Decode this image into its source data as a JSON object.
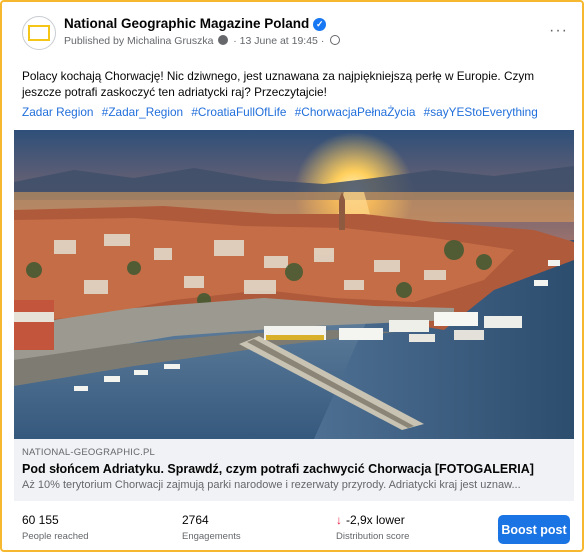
{
  "post": {
    "page_name": "National Geographic Magazine Poland",
    "meta": {
      "published_by": "Published by Michalina Gruszka",
      "date": "· 13 June at 19:45 ·"
    },
    "more_label": "···",
    "text": "Polacy kochają Chorwację! Nic dziwnego, jest uznawana za najpiękniejszą perłę w Europie. Czym jeszcze potrafi zaskoczyć ten adriatycki raj? Przeczytajcie!",
    "hashtags": [
      "Zadar Region",
      "#Zadar_Region",
      "#CroatiaFullOfLife",
      "#ChorwacjaPełnaŻycia",
      "#sayYEStoEverything"
    ],
    "avatar_text": "NATIONAL GEOGRAPHIC"
  },
  "link_preview": {
    "domain": "NATIONAL-GEOGRAPHIC.PL",
    "title": "Pod słońcem Adriatyku. Sprawdź, czym potrafi zachwycić Chorwacja [FOTOGALERIA]",
    "description": "Aż 10% terytorium Chorwacji zajmują parki narodowe i rezerwaty przyrody. Adriatycki kraj jest uznaw..."
  },
  "insights": {
    "reached_value": "60 155",
    "reached_label": "People reached",
    "engagements_value": "2764",
    "engagements_label": "Engagements",
    "distribution_arrow": "↓",
    "distribution_value": "-2,9x lower",
    "distribution_label": "Distribution score",
    "boost_label": "Boost post"
  },
  "colors": {
    "accent": "#1b74e4",
    "hashtag": "#216fdb",
    "warning": "#e41e3f",
    "frame": "#f5b82e"
  },
  "icons": [
    "verified-badge-icon",
    "privacy-dot-icon",
    "globe-icon",
    "more-options-icon",
    "down-arrow-icon"
  ]
}
